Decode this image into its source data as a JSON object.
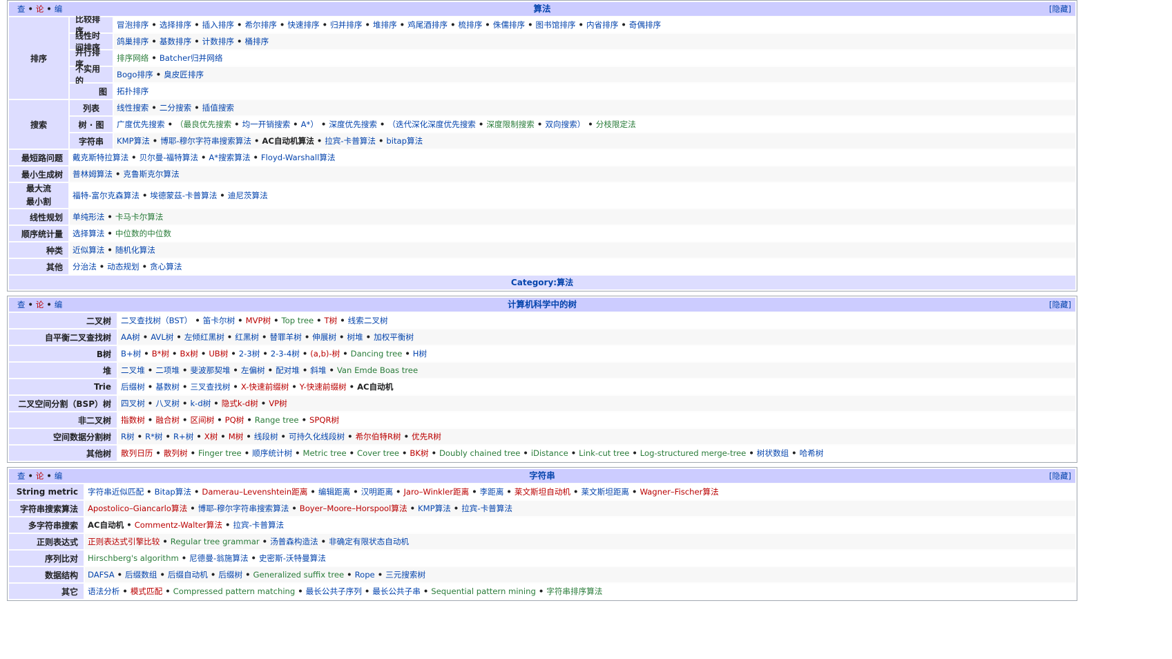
{
  "navboxes": [
    {
      "vde": [
        "查",
        "论",
        "编"
      ],
      "title": "算法",
      "hide": "[隐藏]",
      "footer": "Category:算法"
    },
    {
      "vde": [
        "查",
        "论",
        "编"
      ],
      "title": "计算机科学中的树",
      "hide": "[隐藏]"
    },
    {
      "vde": [
        "查",
        "论",
        "编"
      ],
      "title": "字符串",
      "hide": "[隐藏]"
    }
  ],
  "algo": {
    "sort": {
      "label": "排序",
      "rows": [
        {
          "label": "比较排序",
          "items": [
            [
              "冒泡排序",
              "blue"
            ],
            [
              "选择排序",
              "blue"
            ],
            [
              "插入排序",
              "blue"
            ],
            [
              "希尔排序",
              "blue"
            ],
            [
              "快速排序",
              "blue"
            ],
            [
              "归并排序",
              "blue"
            ],
            [
              "堆排序",
              "blue"
            ],
            [
              "鸡尾酒排序",
              "blue"
            ],
            [
              "梳排序",
              "blue"
            ],
            [
              "侏儒排序",
              "blue"
            ],
            [
              "图书馆排序",
              "blue"
            ],
            [
              "内省排序",
              "blue"
            ],
            [
              "奇偶排序",
              "blue"
            ]
          ]
        },
        {
          "label": "线性时间排序",
          "items": [
            [
              "鸽巢排序",
              "blue"
            ],
            [
              "基数排序",
              "blue"
            ],
            [
              "计数排序",
              "blue"
            ],
            [
              "桶排序",
              "blue"
            ]
          ]
        },
        {
          "label": "并行排序",
          "items": [
            [
              "排序网络",
              "green"
            ],
            [
              "Batcher归并网络",
              "blue"
            ]
          ]
        },
        {
          "label": "不实用的",
          "items": [
            [
              "Bogo排序",
              "blue"
            ],
            [
              "臭皮匠排序",
              "blue"
            ]
          ]
        },
        {
          "label": "图",
          "items": [
            [
              "拓扑排序",
              "blue"
            ]
          ]
        }
      ]
    },
    "search": {
      "label": "搜索",
      "rows": [
        {
          "label": "列表",
          "items": [
            [
              "线性搜索",
              "blue"
            ],
            [
              "二分搜索",
              "blue"
            ],
            [
              "插值搜索",
              "blue"
            ]
          ]
        },
        {
          "label": "树 · 图",
          "items": [
            [
              "广度优先搜索",
              "blue"
            ],
            [
              "（最良优先搜索",
              "green"
            ],
            [
              "均一开销搜索",
              "blue"
            ],
            [
              "A*）",
              "blue"
            ],
            [
              "深度优先搜索",
              "blue"
            ],
            [
              "（迭代深化深度优先搜索",
              "blue"
            ],
            [
              "深度限制搜索",
              "green"
            ],
            [
              "双向搜索）",
              "blue"
            ],
            [
              "分枝限定法",
              "green"
            ]
          ]
        },
        {
          "label": "字符串",
          "items": [
            [
              "KMP算法",
              "blue"
            ],
            [
              "博耶-穆尔字符串搜索算法",
              "blue"
            ],
            [
              "AC自动机算法",
              "black"
            ],
            [
              "拉宾-卡普算法",
              "blue"
            ],
            [
              "bitap算法",
              "blue"
            ]
          ]
        }
      ]
    },
    "rows": [
      {
        "label": "最短路问题",
        "items": [
          [
            "戴克斯特拉算法",
            "blue"
          ],
          [
            "贝尔曼-福特算法",
            "blue"
          ],
          [
            "A*搜索算法",
            "blue"
          ],
          [
            "Floyd-Warshall算法",
            "blue"
          ]
        ]
      },
      {
        "label": "最小生成树",
        "items": [
          [
            "普林姆算法",
            "blue"
          ],
          [
            "克鲁斯克尔算法",
            "blue"
          ]
        ]
      },
      {
        "label": "最大流最小割",
        "label_lines": [
          "最大流",
          "最小割"
        ],
        "items": [
          [
            "福特-富尔克森算法",
            "blue"
          ],
          [
            "埃德蒙茲-卡普算法",
            "blue"
          ],
          [
            "迪尼茨算法",
            "blue"
          ]
        ]
      },
      {
        "label": "线性规划",
        "items": [
          [
            "单纯形法",
            "blue"
          ],
          [
            "卡马卡尔算法",
            "green"
          ]
        ]
      },
      {
        "label": "顺序统计量",
        "items": [
          [
            "选择算法",
            "blue"
          ],
          [
            "中位数的中位数",
            "green"
          ]
        ]
      },
      {
        "label": "种类",
        "items": [
          [
            "近似算法",
            "blue"
          ],
          [
            "随机化算法",
            "blue"
          ]
        ]
      },
      {
        "label": "其他",
        "items": [
          [
            "分治法",
            "blue"
          ],
          [
            "动态规划",
            "blue"
          ],
          [
            "贪心算法",
            "blue"
          ]
        ]
      }
    ]
  },
  "trees": {
    "rows": [
      {
        "label": "二叉树",
        "items": [
          [
            "二叉查找树（BST）",
            "blue"
          ],
          [
            "笛卡尔树",
            "blue"
          ],
          [
            "MVP树",
            "red"
          ],
          [
            "Top tree",
            "green"
          ],
          [
            "T树",
            "red"
          ],
          [
            "线索二叉树",
            "blue"
          ]
        ]
      },
      {
        "label": "自平衡二叉查找树",
        "items": [
          [
            "AA树",
            "blue"
          ],
          [
            "AVL树",
            "blue"
          ],
          [
            "左倾红黑树",
            "blue"
          ],
          [
            "红黑树",
            "blue"
          ],
          [
            "替罪羊树",
            "blue"
          ],
          [
            "伸展树",
            "blue"
          ],
          [
            "树堆",
            "blue"
          ],
          [
            "加权平衡树",
            "blue"
          ]
        ]
      },
      {
        "label": "B树",
        "items": [
          [
            "B+树",
            "blue"
          ],
          [
            "B*树",
            "red"
          ],
          [
            "Bx树",
            "red"
          ],
          [
            "UB树",
            "red"
          ],
          [
            "2-3树",
            "blue"
          ],
          [
            "2-3-4树",
            "blue"
          ],
          [
            "(a,b)-树",
            "red"
          ],
          [
            "Dancing tree",
            "green"
          ],
          [
            "H树",
            "blue"
          ]
        ]
      },
      {
        "label": "堆",
        "items": [
          [
            "二叉堆",
            "blue"
          ],
          [
            "二项堆",
            "blue"
          ],
          [
            "斐波那契堆",
            "blue"
          ],
          [
            "左偏树",
            "blue"
          ],
          [
            "配对堆",
            "blue"
          ],
          [
            "斜堆",
            "blue"
          ],
          [
            "Van Emde Boas tree",
            "green"
          ]
        ]
      },
      {
        "label": "Trie",
        "items": [
          [
            "后缀树",
            "blue"
          ],
          [
            "基数树",
            "blue"
          ],
          [
            "三叉查找树",
            "blue"
          ],
          [
            "X-快速前缀树",
            "red"
          ],
          [
            "Y-快速前缀树",
            "red"
          ],
          [
            "AC自动机",
            "black"
          ]
        ]
      },
      {
        "label": "二叉空间分割（BSP）树",
        "items": [
          [
            "四叉树",
            "blue"
          ],
          [
            "八叉树",
            "blue"
          ],
          [
            "k-d树",
            "blue"
          ],
          [
            "隐式k-d树",
            "red"
          ],
          [
            "VP树",
            "red"
          ]
        ]
      },
      {
        "label": "非二叉树",
        "items": [
          [
            "指数树",
            "red"
          ],
          [
            "融合树",
            "red"
          ],
          [
            "区间树",
            "red"
          ],
          [
            "PQ树",
            "red"
          ],
          [
            "Range tree",
            "green"
          ],
          [
            "SPQR树",
            "red"
          ]
        ]
      },
      {
        "label": "空间数据分割树",
        "items": [
          [
            "R树",
            "blue"
          ],
          [
            "R*树",
            "blue"
          ],
          [
            "R+树",
            "blue"
          ],
          [
            "X树",
            "red"
          ],
          [
            "M树",
            "red"
          ],
          [
            "线段树",
            "blue"
          ],
          [
            "可持久化线段树",
            "blue"
          ],
          [
            "希尔伯特R树",
            "red"
          ],
          [
            "优先R树",
            "red"
          ]
        ]
      },
      {
        "label": "其他树",
        "items": [
          [
            "散列日历",
            "red"
          ],
          [
            "散列树",
            "red"
          ],
          [
            "Finger tree",
            "green"
          ],
          [
            "顺序统计树",
            "blue"
          ],
          [
            "Metric tree",
            "green"
          ],
          [
            "Cover tree",
            "green"
          ],
          [
            "BK树",
            "red"
          ],
          [
            "Doubly chained tree",
            "green"
          ],
          [
            "iDistance",
            "green"
          ],
          [
            "Link-cut tree",
            "green"
          ],
          [
            "Log-structured merge-tree",
            "green"
          ],
          [
            "树状数组",
            "blue"
          ],
          [
            "哈希树",
            "blue"
          ]
        ]
      }
    ]
  },
  "strings": {
    "rows": [
      {
        "label": "String metric",
        "items": [
          [
            "字符串近似匹配",
            "blue"
          ],
          [
            "Bitap算法",
            "blue"
          ],
          [
            "Damerau–Levenshtein距离",
            "red"
          ],
          [
            "编辑距离",
            "blue"
          ],
          [
            "汉明距离",
            "blue"
          ],
          [
            "Jaro–Winkler距离",
            "red"
          ],
          [
            "李距离",
            "blue"
          ],
          [
            "莱文斯坦自动机",
            "red"
          ],
          [
            "莱文斯坦距离",
            "blue"
          ],
          [
            "Wagner–Fischer算法",
            "red"
          ]
        ]
      },
      {
        "label": "字符串搜索算法",
        "items": [
          [
            "Apostolico–Giancarlo算法",
            "red"
          ],
          [
            "博耶-穆尔字符串搜索算法",
            "blue"
          ],
          [
            "Boyer–Moore–Horspool算法",
            "red"
          ],
          [
            "KMP算法",
            "blue"
          ],
          [
            "拉宾-卡普算法",
            "blue"
          ]
        ]
      },
      {
        "label": "多字符串搜索",
        "items": [
          [
            "AC自动机",
            "black"
          ],
          [
            "Commentz-Walter算法",
            "red"
          ],
          [
            "拉宾-卡普算法",
            "blue"
          ]
        ]
      },
      {
        "label": "正则表达式",
        "items": [
          [
            "正则表达式引擎比较",
            "red"
          ],
          [
            "Regular tree grammar",
            "green"
          ],
          [
            "汤普森构造法",
            "blue"
          ],
          [
            "非确定有限状态自动机",
            "blue"
          ]
        ]
      },
      {
        "label": "序列比对",
        "items": [
          [
            "Hirschberg's algorithm",
            "green"
          ],
          [
            "尼德曼-翁施算法",
            "blue"
          ],
          [
            "史密斯-沃特曼算法",
            "blue"
          ]
        ]
      },
      {
        "label": "数据结构",
        "items": [
          [
            "DAFSA",
            "blue"
          ],
          [
            "后缀数组",
            "blue"
          ],
          [
            "后缀自动机",
            "blue"
          ],
          [
            "后缀树",
            "blue"
          ],
          [
            "Generalized suffix tree",
            "green"
          ],
          [
            "Rope",
            "blue"
          ],
          [
            "三元搜索树",
            "blue"
          ]
        ]
      },
      {
        "label": "其它",
        "items": [
          [
            "语法分析",
            "blue"
          ],
          [
            "模式匹配",
            "red"
          ],
          [
            "Compressed pattern matching",
            "green"
          ],
          [
            "最长公共子序列",
            "blue"
          ],
          [
            "最长公共子串",
            "blue"
          ],
          [
            "Sequential pattern mining",
            "green"
          ],
          [
            "字符串排序算法",
            "green"
          ]
        ]
      }
    ]
  },
  "colors": {
    "blue": "#0645ad",
    "red": "#ba0000",
    "green": "#2a7c3a",
    "header_bg": "#ccccff",
    "group_bg": "#ddddff"
  }
}
